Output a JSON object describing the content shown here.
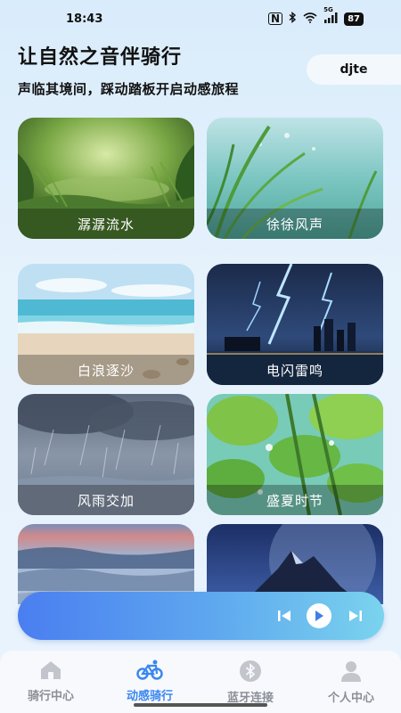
{
  "status_bar": {
    "time": "18:43",
    "signal": "5G",
    "battery": "87"
  },
  "header": {
    "title": "让自然之音伴骑行",
    "subtitle": "声临其境间，踩动踏板开启动感旅程",
    "user": "djte"
  },
  "scenes": [
    {
      "label": "潺潺流水"
    },
    {
      "label": "徐徐风声"
    },
    {
      "label": "白浪逐沙"
    },
    {
      "label": "电闪雷鸣"
    },
    {
      "label": "风雨交加"
    },
    {
      "label": "盛夏时节"
    }
  ],
  "player": {
    "icons": [
      "prev-icon",
      "play-icon",
      "next-icon"
    ]
  },
  "nav": {
    "items": [
      {
        "label": "骑行中心",
        "icon": "home-icon",
        "active": false
      },
      {
        "label": "动感骑行",
        "icon": "bicycle-icon",
        "active": true
      },
      {
        "label": "蓝牙连接",
        "icon": "bluetooth-icon",
        "active": false
      },
      {
        "label": "个人中心",
        "icon": "person-icon",
        "active": false
      }
    ]
  },
  "colors": {
    "accent": "#3b87f0",
    "player_start": "#4a7ef0",
    "player_end": "#7ad3ee"
  }
}
